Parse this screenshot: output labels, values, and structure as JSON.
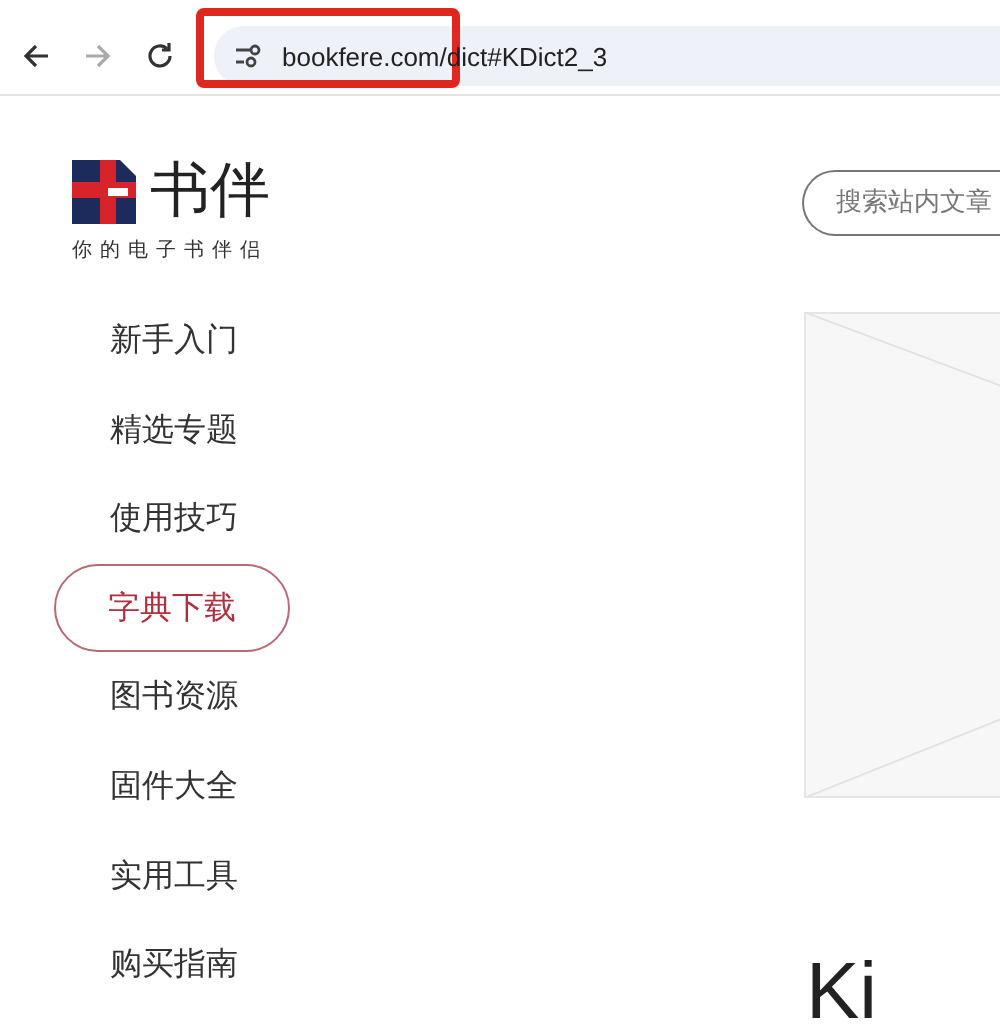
{
  "browser": {
    "url": "bookfere.com/dict#KDict2_3",
    "url_highlighted": true,
    "forward_enabled": false
  },
  "site": {
    "logo": {
      "name": "书伴",
      "tagline": "你的电子书伴侣"
    },
    "nav": [
      {
        "label": "新手入门",
        "selected": false
      },
      {
        "label": "精选专题",
        "selected": false
      },
      {
        "label": "使用技巧",
        "selected": false
      },
      {
        "label": "字典下载",
        "selected": true
      },
      {
        "label": "图书资源",
        "selected": false
      },
      {
        "label": "固件大全",
        "selected": false
      },
      {
        "label": "实用工具",
        "selected": false
      },
      {
        "label": "购买指南",
        "selected": false
      }
    ],
    "search": {
      "placeholder": "搜索站内文章"
    },
    "article_heading": "Ki"
  }
}
